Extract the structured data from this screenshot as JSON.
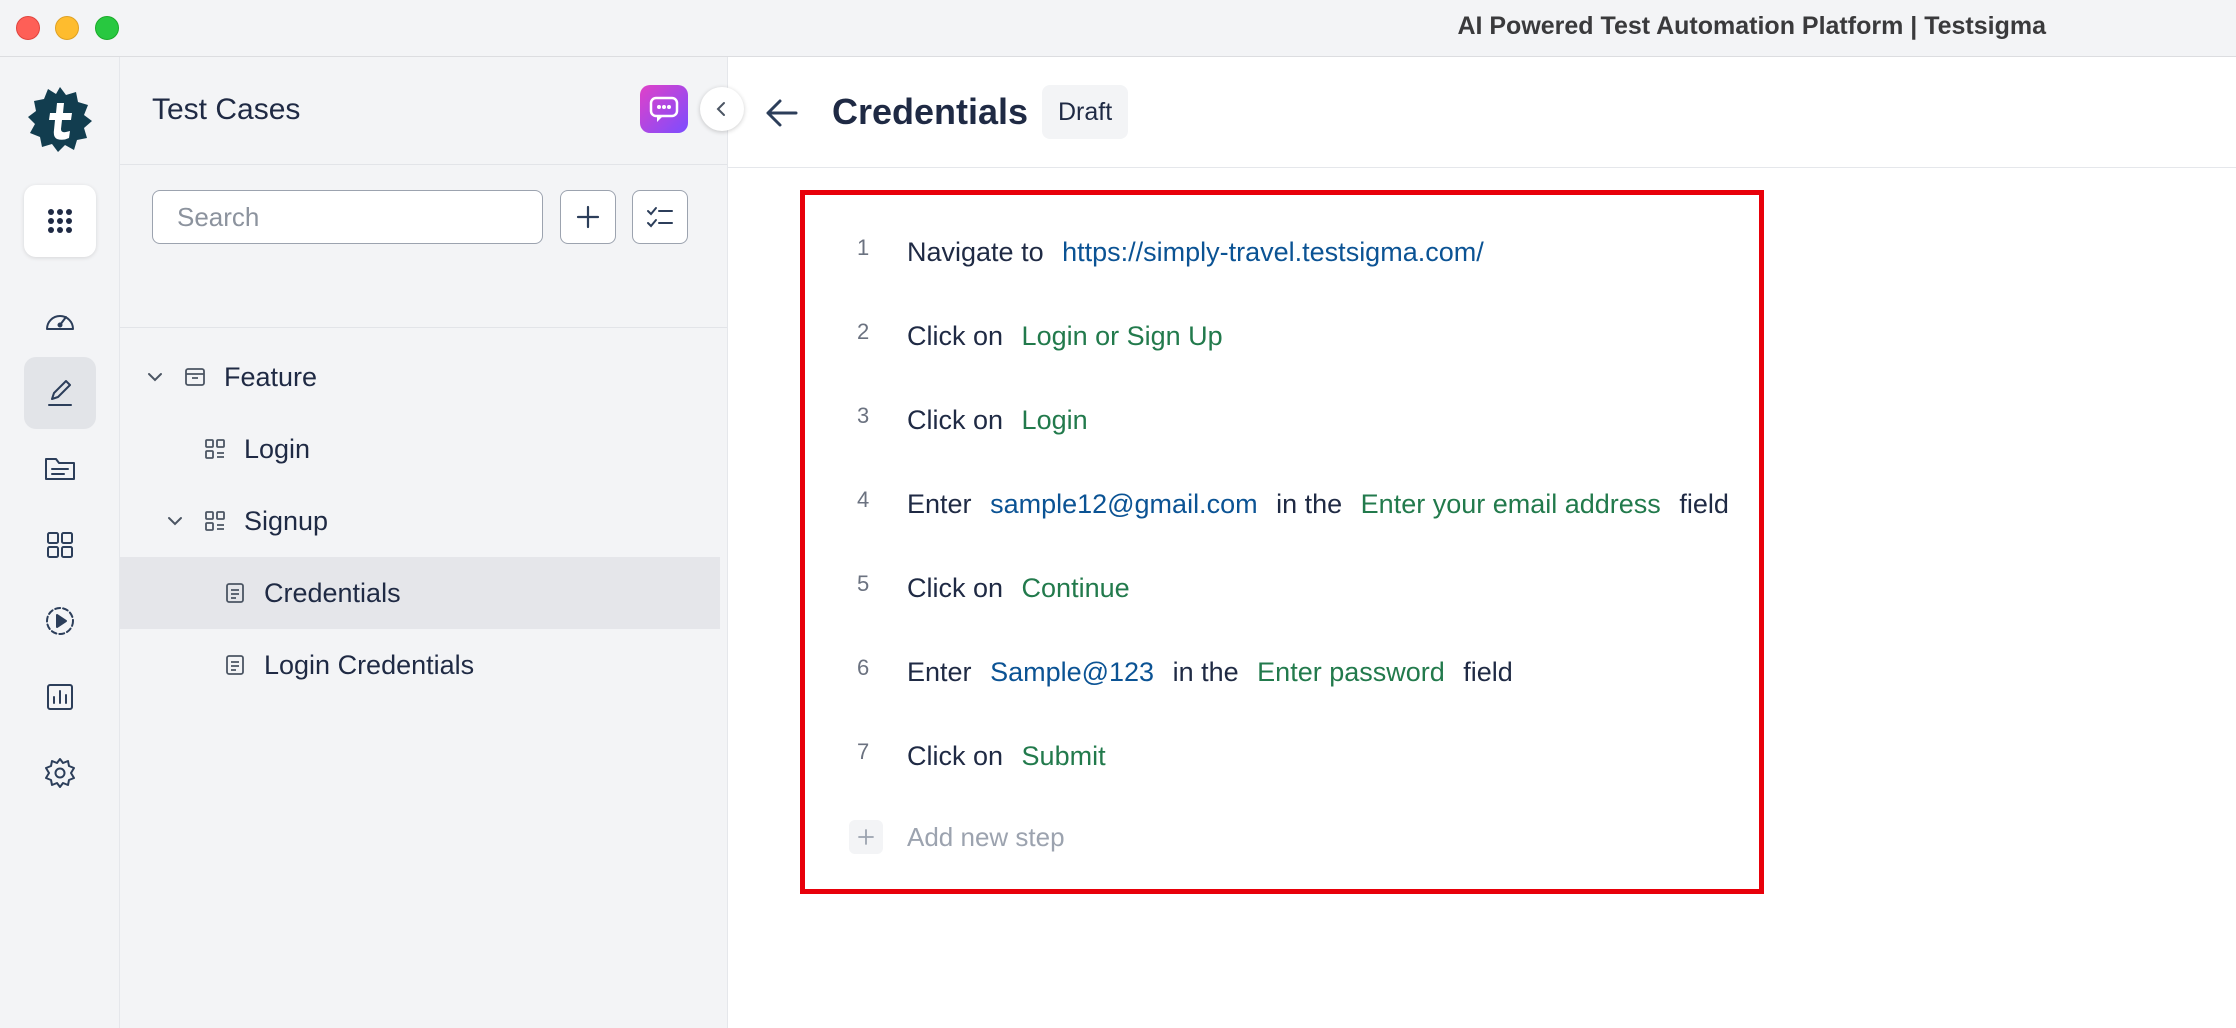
{
  "window": {
    "title": "AI Powered Test Automation Platform | Testsigma"
  },
  "rail": {
    "items": [
      "apps-grid-icon",
      "dashboard-icon",
      "test-cases-icon",
      "folder-icon",
      "elements-icon",
      "runs-icon",
      "reports-icon",
      "settings-icon"
    ]
  },
  "panel": {
    "title": "Test Cases",
    "search_placeholder": "Search",
    "tree": [
      {
        "label": "Feature",
        "type": "feature",
        "expanded": true
      },
      {
        "label": "Login",
        "type": "suite"
      },
      {
        "label": "Signup",
        "type": "suite",
        "expanded": true
      },
      {
        "label": "Credentials",
        "type": "case",
        "selected": true
      },
      {
        "label": "Login Credentials",
        "type": "case"
      }
    ]
  },
  "main": {
    "title": "Credentials",
    "status": "Draft",
    "steps": [
      {
        "num": "1",
        "parts": [
          "Navigate to",
          "https://simply-travel.testsigma.com/"
        ]
      },
      {
        "num": "2",
        "parts": [
          "Click on",
          "Login or Sign Up"
        ]
      },
      {
        "num": "3",
        "parts": [
          "Click on",
          "Login"
        ]
      },
      {
        "num": "4",
        "parts": [
          "Enter",
          "sample12@gmail.com",
          "in the",
          "Enter your email address",
          "field"
        ]
      },
      {
        "num": "5",
        "parts": [
          "Click on",
          "Continue"
        ]
      },
      {
        "num": "6",
        "parts": [
          "Enter",
          "Sample@123",
          "in the",
          "Enter password",
          "field"
        ]
      },
      {
        "num": "7",
        "parts": [
          "Click on",
          "Submit"
        ]
      }
    ],
    "add_step_label": "Add new step"
  },
  "colors": {
    "highlight_border": "#e8000a",
    "value_text": "#0b5394",
    "element_text": "#227a4c",
    "selected_row": "#e5e6ea"
  }
}
